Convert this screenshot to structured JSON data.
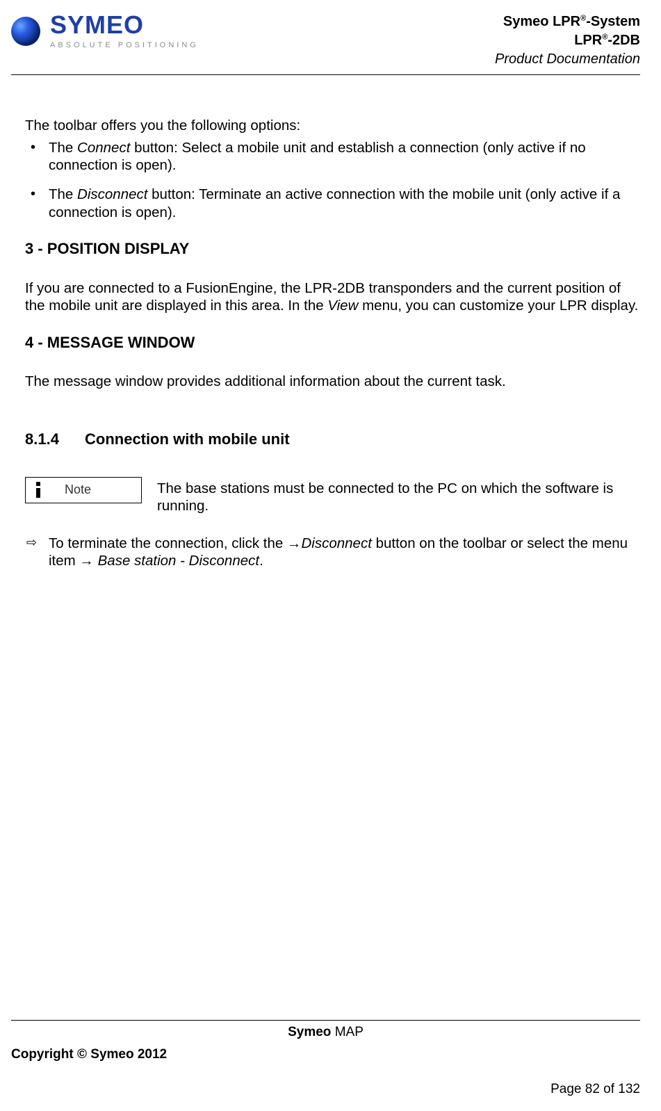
{
  "header": {
    "logo_word": "SYMEO",
    "logo_tag": "ABSOLUTE POSITIONING",
    "title_line1_a": "Symeo LPR",
    "title_line1_b": "-System",
    "title_line2_a": "LPR",
    "title_line2_b": "-2DB",
    "title_line3": "Product Documentation",
    "reg": "®"
  },
  "body": {
    "intro": "The toolbar offers you the following options:",
    "bullets": [
      {
        "pre": "The ",
        "em": "Connect",
        "post": " button: Select a mobile unit and establish a connection (only active if no connection is open)."
      },
      {
        "pre": "The ",
        "em": "Disconnect",
        "post": " button: Terminate an active connection with the mobile unit (only active if a connection is open)."
      }
    ],
    "sec3_title": "3 - POSITION DISPLAY",
    "sec3_text_a": "If you are connected to a FusionEngine, the LPR-2DB  transponders and the current position of the mobile unit are displayed in this area. In the ",
    "sec3_text_em": "View",
    "sec3_text_b": " menu, you can customize your LPR display.",
    "sec4_title": "4 - MESSAGE WINDOW",
    "sec4_text": "The message window provides additional information about the current task.",
    "sub_num": "8.1.4",
    "sub_title": "Connection with mobile unit",
    "note_label": "Note",
    "note_text": "The base stations must be connected to the PC on which the software is running.",
    "arrow_a": "To terminate the connection, click the →",
    "arrow_em1": "Disconnect",
    "arrow_b": " button on the toolbar or select the menu item → ",
    "arrow_em2": "Base station - Disconnect",
    "arrow_c": "."
  },
  "footer": {
    "center_a": "Symeo",
    "center_b": " MAP",
    "copyright": "Copyright © Symeo 2012",
    "page": "Page 82 of 132"
  }
}
